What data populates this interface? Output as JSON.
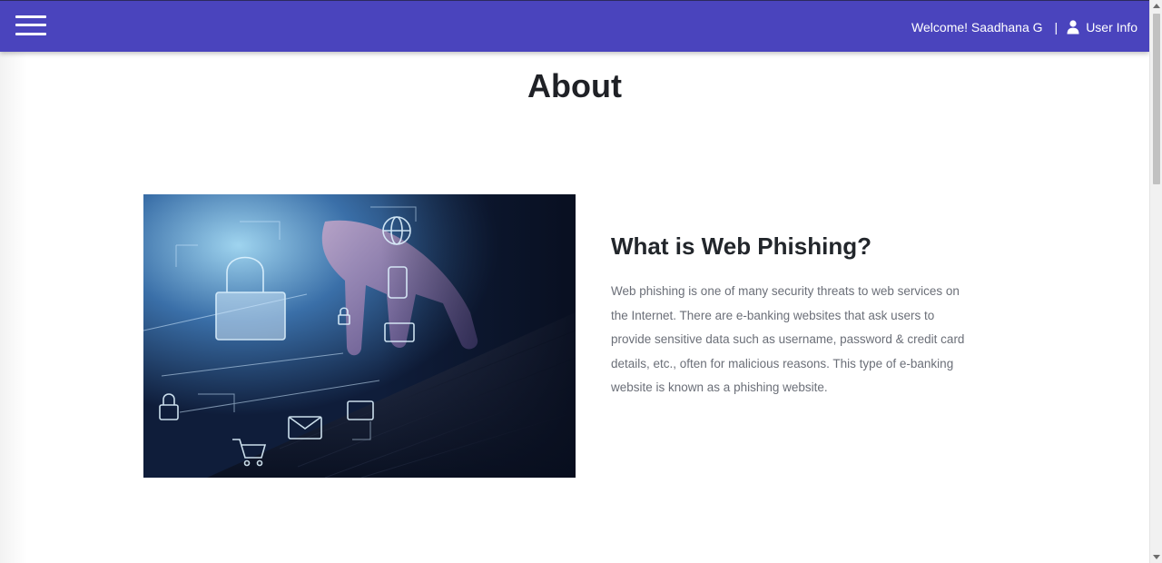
{
  "navbar": {
    "background": "#4a44bd",
    "menu_icon": "hamburger-menu-icon",
    "welcome_text": "Welcome! Saadhana G",
    "separator": "|",
    "user_icon": "user-icon",
    "user_info_label": "User Info"
  },
  "about": {
    "title": "About",
    "image_alt": "hand-on-laptop-with-security-icons",
    "heading": "What is Web Phishing?",
    "body": "Web phishing is one of many security threats to web services on the Internet. There are e-banking websites that ask users to provide sensitive data such as username, password & credit card details, etc., often for malicious reasons. This type of e-banking website is known as a phishing website."
  }
}
